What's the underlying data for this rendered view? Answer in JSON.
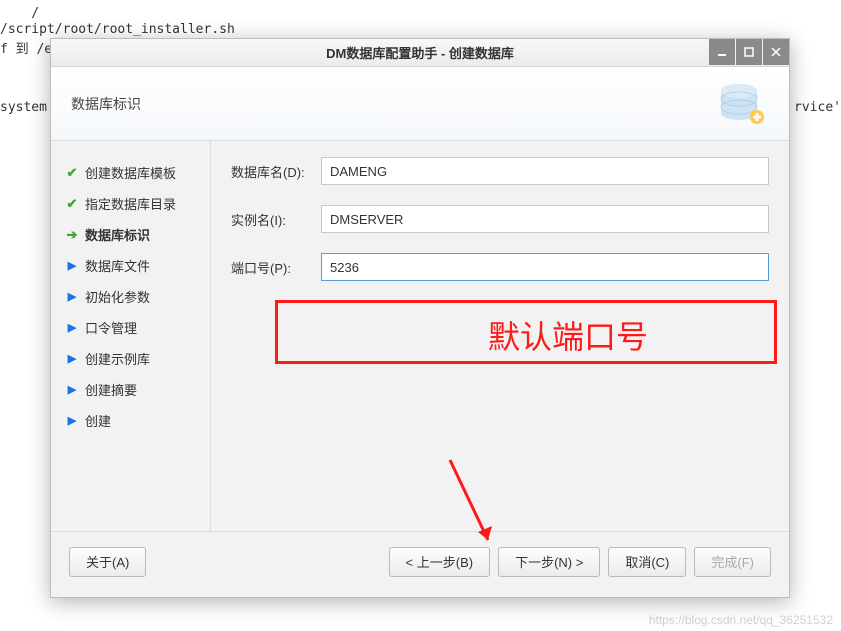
{
  "background": {
    "line1": "    /",
    "line2": "/script/root/root_installer.sh",
    "line3": "f 到 /e",
    "line4": "system",
    "line4_right": "rvice'"
  },
  "dialog": {
    "title": "DM数据库配置助手 - 创建数据库",
    "header": "数据库标识",
    "steps": [
      {
        "label": "创建数据库模板",
        "state": "done"
      },
      {
        "label": "指定数据库目录",
        "state": "done"
      },
      {
        "label": "数据库标识",
        "state": "current"
      },
      {
        "label": "数据库文件",
        "state": "pending"
      },
      {
        "label": "初始化参数",
        "state": "pending"
      },
      {
        "label": "口令管理",
        "state": "pending"
      },
      {
        "label": "创建示例库",
        "state": "pending"
      },
      {
        "label": "创建摘要",
        "state": "pending"
      },
      {
        "label": "创建",
        "state": "pending"
      }
    ],
    "form": {
      "db_name_label": "数据库名(D):",
      "db_name_value": "DAMENG",
      "instance_label": "实例名(I):",
      "instance_value": "DMSERVER",
      "port_label": "端口号(P):",
      "port_value": "5236"
    },
    "buttons": {
      "about": "关于(A)",
      "prev": "< 上一步(B)",
      "next": "下一步(N) >",
      "cancel": "取消(C)",
      "finish": "完成(F)"
    }
  },
  "annotation": {
    "text": "默认端口号"
  },
  "watermark": "https://blog.csdn.net/qq_36251532"
}
